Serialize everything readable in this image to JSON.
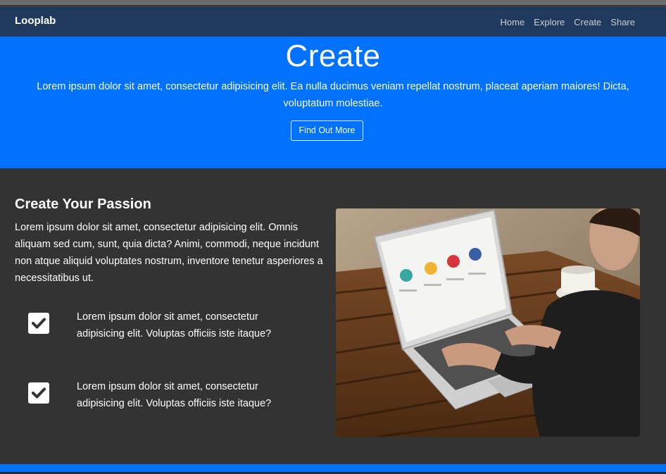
{
  "navbar": {
    "brand": "Looplab",
    "links": [
      "Home",
      "Explore",
      "Create",
      "Share"
    ]
  },
  "hero": {
    "title": "Create",
    "text": "Lorem ipsum dolor sit amet, consectetur adipisicing elit. Ea nulla ducimus veniam repellat nostrum, placeat aperiam maiores! Dicta, voluptatum molestiae.",
    "button": "Find Out More"
  },
  "section": {
    "title": "Create Your Passion",
    "text": "Lorem ipsum dolor sit amet, consectetur adipisicing elit. Omnis aliquam sed cum, sunt, quia dicta? Animi, commodi, neque incidunt non atque aliquid voluptates nostrum, inventore tenetur asperiores a necessitatibus ut.",
    "features": [
      {
        "icon": "check-square-icon",
        "text": "Lorem ipsum dolor sit amet, consectetur adipisicing elit. Voluptas officiis iste itaque?"
      },
      {
        "icon": "check-square-icon",
        "text": "Lorem ipsum dolor sit amet, consectetur adipisicing elit. Voluptas officiis iste itaque?"
      }
    ],
    "image_icon": "laptop-photo"
  },
  "colors": {
    "navbar": "#1f3a5c",
    "accent": "#0072ff",
    "section_bg": "#333333"
  }
}
